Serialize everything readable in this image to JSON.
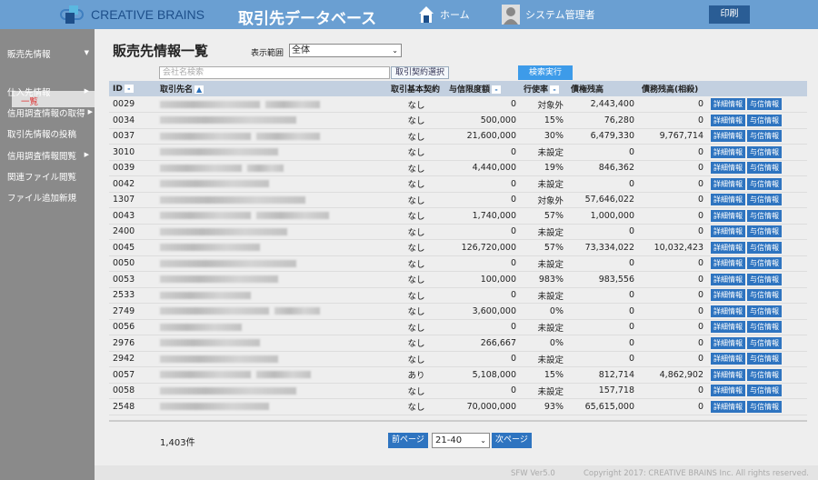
{
  "header": {
    "logo": "CREATIVE BRAINS",
    "title": "取引先データベース",
    "home": "ホーム",
    "user": "システム管理者",
    "print": "印刷",
    "colors": {
      "bar": "#6a9fd2",
      "button": "#2a5d95"
    }
  },
  "sidebar": {
    "items": [
      {
        "label": "販売先情報",
        "arrow": "▼"
      },
      {
        "label": "仕入先情報",
        "arrow": "▶"
      },
      {
        "label": "信用調査情報の取得",
        "arrow": "▶"
      },
      {
        "label": "取引先情報の投稿",
        "arrow": ""
      },
      {
        "label": "信用調査情報閲覧",
        "arrow": "▶"
      },
      {
        "label": "関連ファイル閲覧",
        "arrow": ""
      },
      {
        "label": "ファイル追加新規",
        "arrow": ""
      }
    ],
    "sub_active": "一覧"
  },
  "main": {
    "title": "販売先情報一覧",
    "range_label": "表示範囲",
    "range_value": "全体",
    "search_placeholder": "会社名検索",
    "contract_select": "取引契約選択",
    "search_button": "検索実行"
  },
  "table": {
    "headers": [
      "ID",
      "取引先名",
      "取引基本契約",
      "与信限度額",
      "行使率",
      "債権残高",
      "債務残高(相殺)"
    ],
    "sort_marks": {
      "id": "-",
      "name": "▲",
      "limit": "-",
      "rate": "-"
    },
    "detail_label": "詳細情報",
    "credit_label": "与信情報",
    "rows": [
      [
        "0029",
        "なし",
        "0",
        "対象外",
        "2,443,400",
        "0"
      ],
      [
        "0034",
        "なし",
        "500,000",
        "15%",
        "76,280",
        "0"
      ],
      [
        "0037",
        "なし",
        "21,600,000",
        "30%",
        "6,479,330",
        "9,767,714"
      ],
      [
        "3010",
        "なし",
        "0",
        "未設定",
        "0",
        "0"
      ],
      [
        "0039",
        "なし",
        "4,440,000",
        "19%",
        "846,362",
        "0"
      ],
      [
        "0042",
        "なし",
        "0",
        "未設定",
        "0",
        "0"
      ],
      [
        "1307",
        "なし",
        "0",
        "対象外",
        "57,646,022",
        "0"
      ],
      [
        "0043",
        "なし",
        "1,740,000",
        "57%",
        "1,000,000",
        "0"
      ],
      [
        "2400",
        "なし",
        "0",
        "未設定",
        "0",
        "0"
      ],
      [
        "0045",
        "なし",
        "126,720,000",
        "57%",
        "73,334,022",
        "10,032,423"
      ],
      [
        "0050",
        "なし",
        "0",
        "未設定",
        "0",
        "0"
      ],
      [
        "0053",
        "なし",
        "100,000",
        "983%",
        "983,556",
        "0"
      ],
      [
        "2533",
        "なし",
        "0",
        "未設定",
        "0",
        "0"
      ],
      [
        "2749",
        "なし",
        "3,600,000",
        "0%",
        "0",
        "0"
      ],
      [
        "0056",
        "なし",
        "0",
        "未設定",
        "0",
        "0"
      ],
      [
        "2976",
        "なし",
        "266,667",
        "0%",
        "0",
        "0"
      ],
      [
        "2942",
        "なし",
        "0",
        "未設定",
        "0",
        "0"
      ],
      [
        "0057",
        "あり",
        "5,108,000",
        "15%",
        "812,714",
        "4,862,902"
      ],
      [
        "0058",
        "なし",
        "0",
        "未設定",
        "157,718",
        "0"
      ],
      [
        "2548",
        "なし",
        "70,000,000",
        "93%",
        "65,615,000",
        "0"
      ]
    ]
  },
  "pager": {
    "count": "1,403件",
    "prev": "前ページ",
    "range": "21-40",
    "next": "次ページ"
  },
  "footer": {
    "version": "SFW Ver5.0",
    "copyright": "Copyright 2017: CREATIVE BRAINS Inc. All rights reserved."
  }
}
